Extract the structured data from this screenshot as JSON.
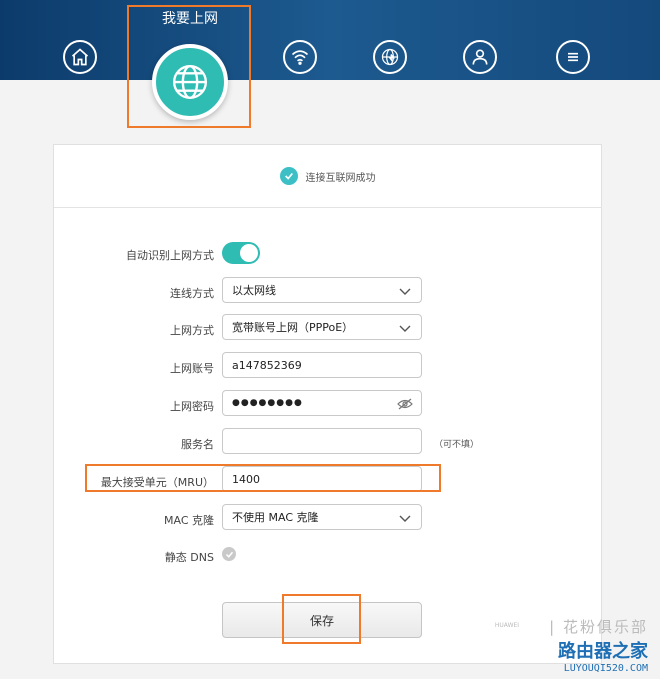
{
  "nav": {
    "active_title": "我要上网",
    "icons": [
      "home-icon",
      "globe-icon",
      "wifi-icon",
      "globe-settings-icon",
      "user-icon",
      "menu-icon"
    ]
  },
  "status": {
    "text": "连接互联网成功"
  },
  "form": {
    "auto_detect_label": "自动识别上网方式",
    "auto_detect_on": true,
    "connection_label": "连线方式",
    "connection_value": "以太网线",
    "access_label": "上网方式",
    "access_value": "宽带账号上网（PPPoE）",
    "account_label": "上网账号",
    "account_value": "a147852369",
    "password_label": "上网密码",
    "password_value": "●●●●●●●●",
    "service_label": "服务名",
    "service_value": "",
    "service_hint": "（可不填）",
    "mru_label": "最大接受单元（MRU）",
    "mru_value": "1400",
    "mac_label": "MAC 克隆",
    "mac_value": "不使用 MAC 克隆",
    "dns_label": "静态 DNS",
    "save_label": "保存"
  },
  "colors": {
    "accent": "#2fbcb3",
    "highlight": "#f07a2c",
    "header": "#0c3b6b"
  },
  "watermark": {
    "huawei": "HUAWEI",
    "brand": "| 花粉俱乐部",
    "logo": "路由器之家",
    "url": "LUYOUQI520.COM"
  }
}
